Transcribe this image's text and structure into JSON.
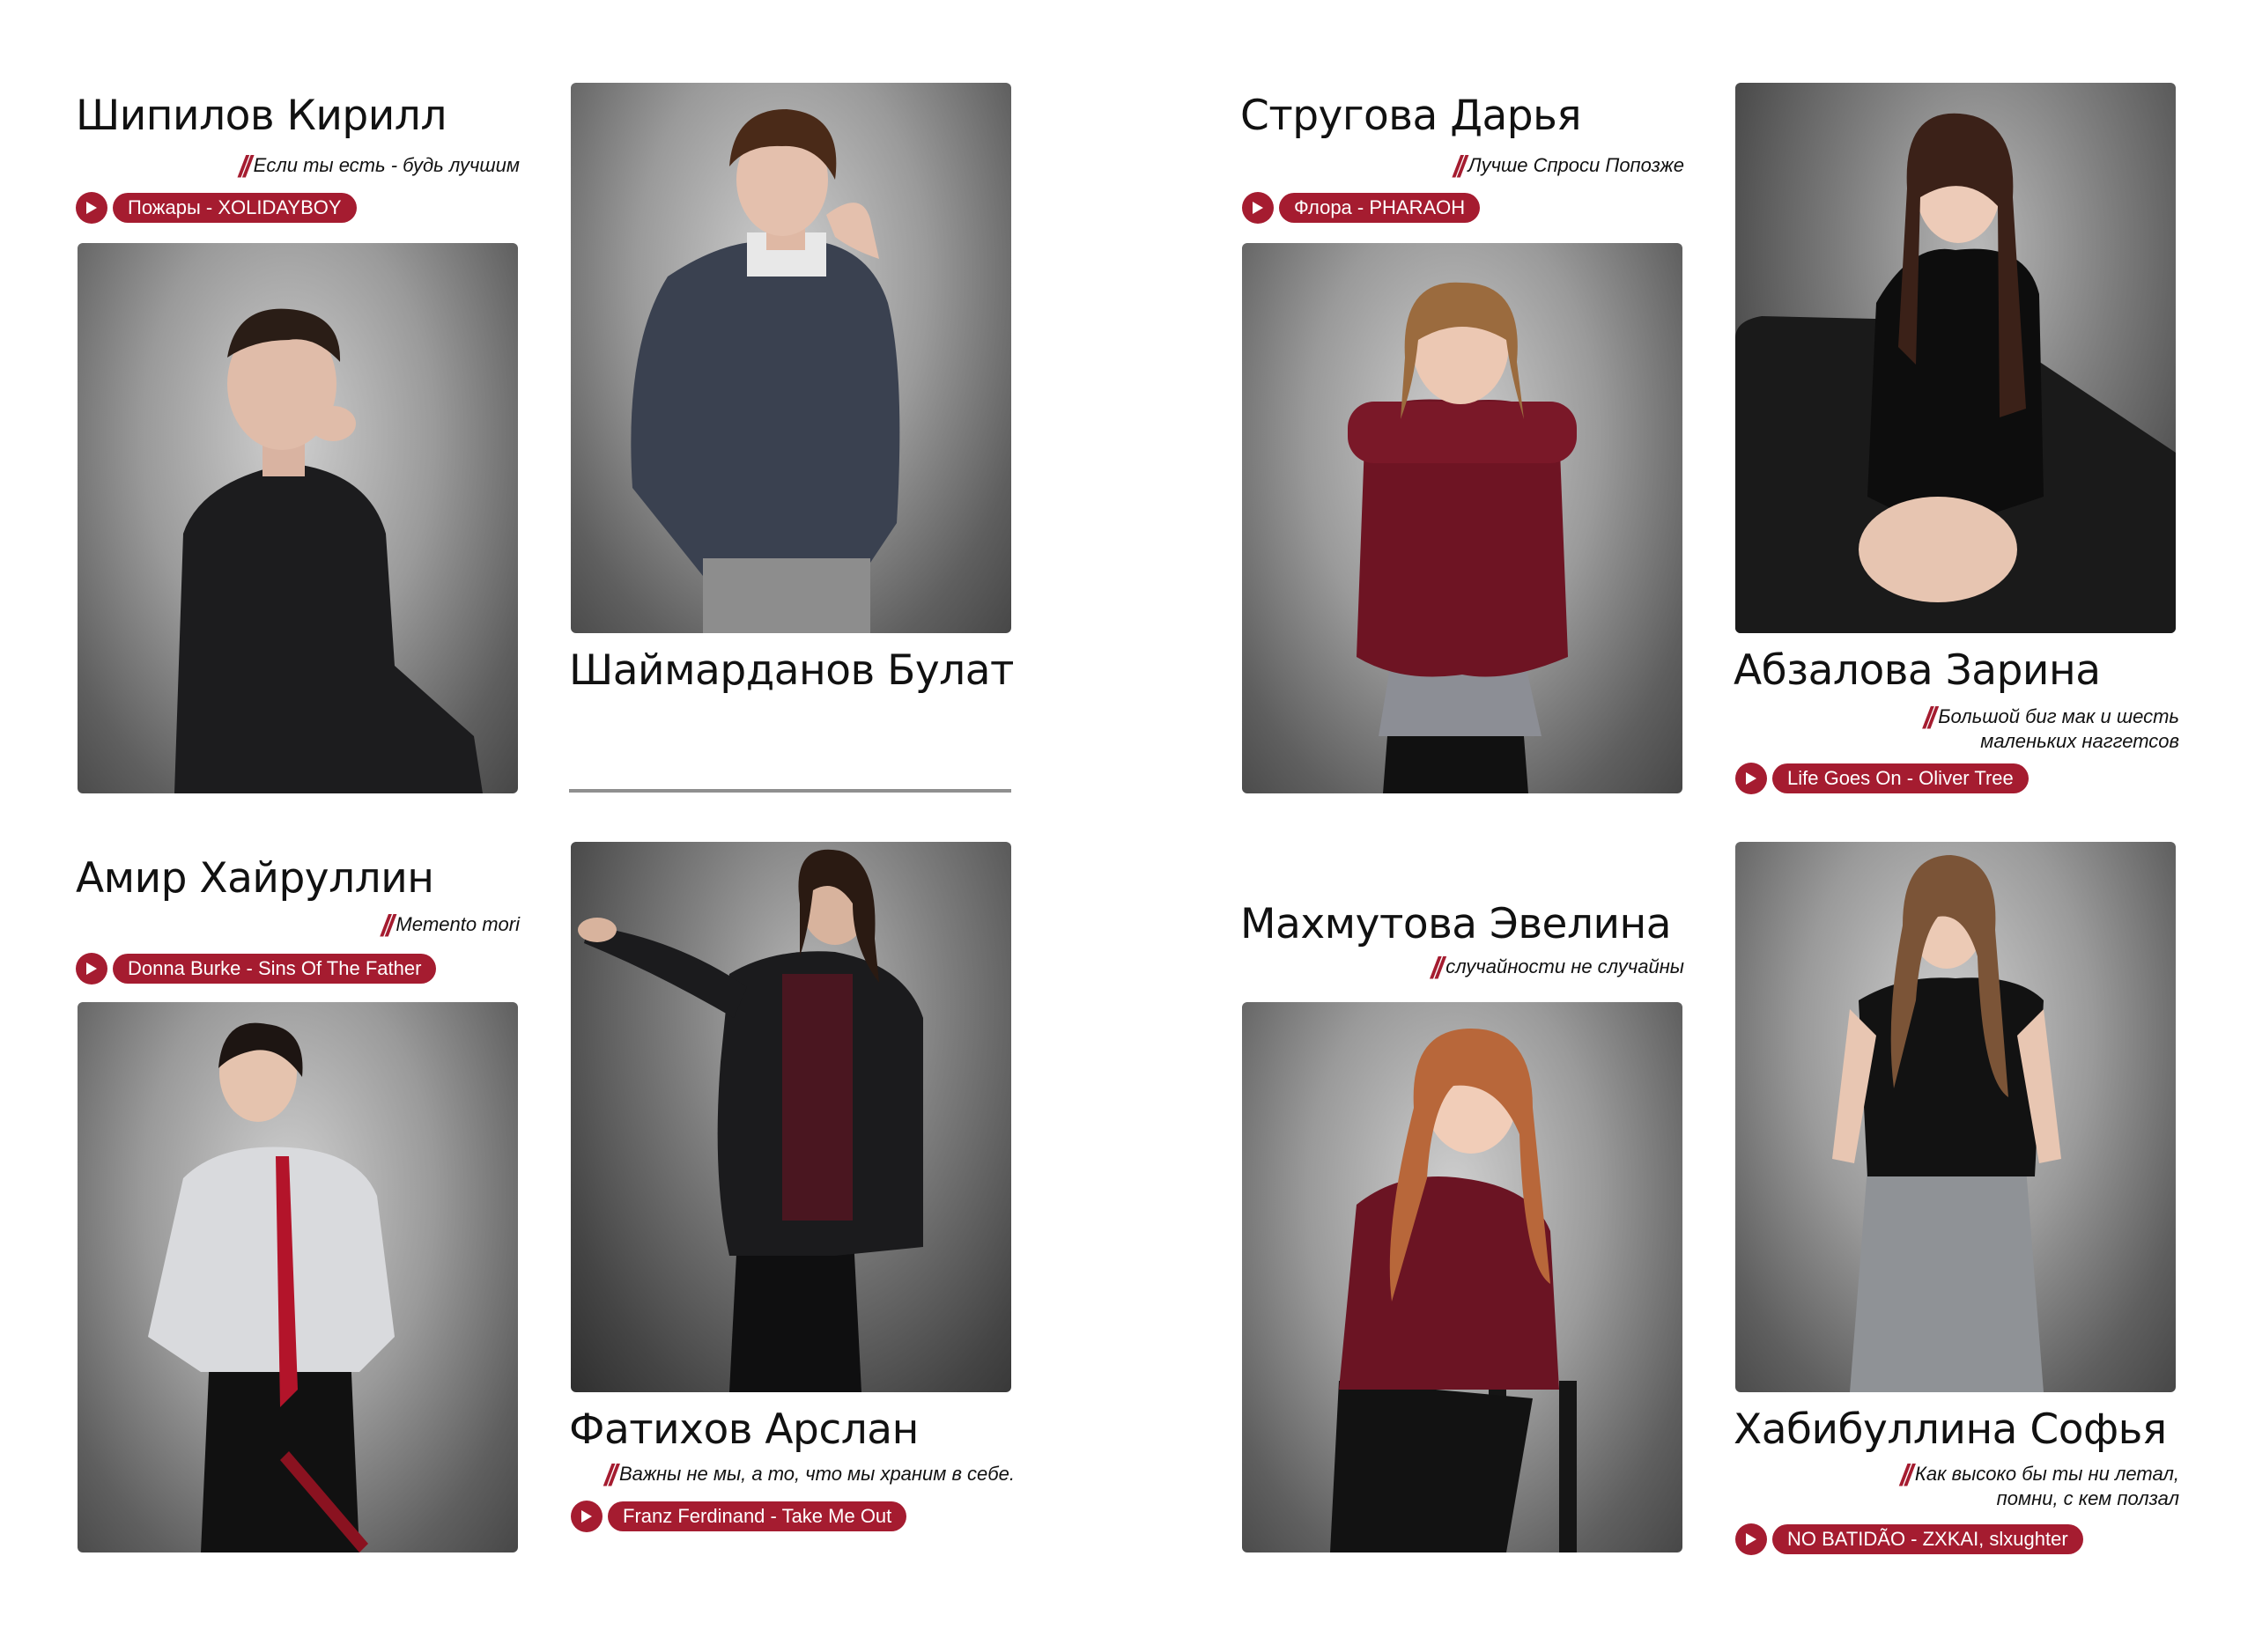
{
  "colors": {
    "accent": "#a51c30",
    "background": "#ffffff",
    "text": "#111111"
  },
  "students": [
    {
      "name": "Шипилов Кирилл",
      "quote": [
        "Если ты есть - будь лучшим"
      ],
      "song": "Пожары - XOLIDAYBOY",
      "icon": "play-icon"
    },
    {
      "name": "Шаймарданов Булат"
    },
    {
      "name": "Стругова Дарья",
      "quote": [
        "Лучше Спроси Попозже"
      ],
      "song": "Флора - PHARAOH",
      "icon": "play-icon"
    },
    {
      "name": "Абзалова Зарина",
      "quote": [
        "Большой биг мак и шесть",
        "маленьких наггетсов"
      ],
      "song": "Life Goes On - Oliver Tree",
      "icon": "play-icon"
    },
    {
      "name": "Амир Хайруллин",
      "quote": [
        "Memento mori"
      ],
      "song": "Donna Burke - Sins Of The Father",
      "icon": "play-icon"
    },
    {
      "name": "Фатихов Арслан",
      "quote": [
        "Важны не мы, а то, что мы храним в себе."
      ],
      "song": "Franz Ferdinand - Take Me Out",
      "icon": "play-icon"
    },
    {
      "name": "Махмутова Эвелина",
      "quote": [
        "случайности не случайны"
      ]
    },
    {
      "name": "Хабибуллина Софья",
      "quote": [
        "Как высоко бы ты ни летал,",
        "помни, с кем ползал"
      ],
      "song": "NO BATIDÃO - ZXKAI, slxughter",
      "icon": "play-icon"
    }
  ]
}
